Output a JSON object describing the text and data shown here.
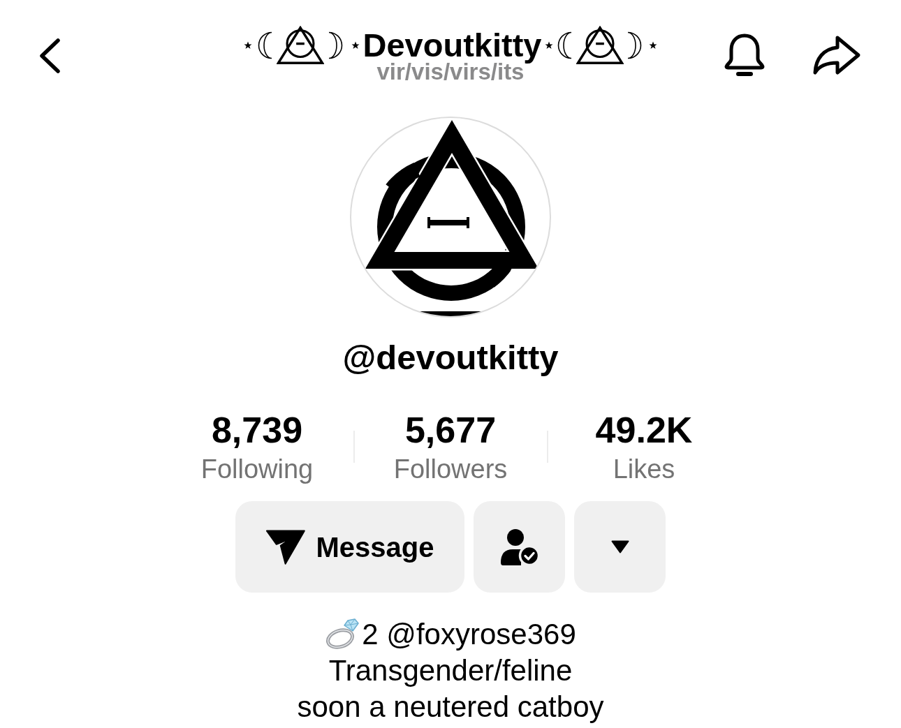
{
  "header": {
    "display_name": "Devoutkitty",
    "pronouns": "vir/vis/virs/its"
  },
  "profile": {
    "username": "@devoutkitty"
  },
  "stats": [
    {
      "value": "8,739",
      "label": "Following"
    },
    {
      "value": "5,677",
      "label": "Followers"
    },
    {
      "value": "49.2K",
      "label": "Likes"
    }
  ],
  "actions": [
    {
      "kind": "message",
      "label": "Message"
    },
    {
      "kind": "following"
    },
    {
      "kind": "more"
    }
  ],
  "bio": [
    {
      "kind": "emoji",
      "text": "2 @foxyrose369"
    },
    {
      "kind": "plain",
      "text": "Transgender/feline"
    },
    {
      "kind": "plain",
      "text": "soon a neutered catboy"
    }
  ]
}
